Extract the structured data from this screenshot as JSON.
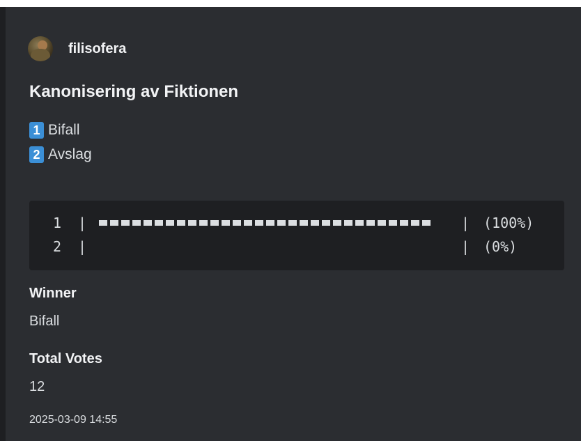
{
  "author": {
    "name": "filisofera",
    "avatar_icon": "avatar-photo"
  },
  "poll": {
    "title": "Kanonisering av Fiktionen",
    "options": [
      {
        "number": "1",
        "label": "Bifall"
      },
      {
        "number": "2",
        "label": "Avslag"
      }
    ]
  },
  "results": {
    "rows": [
      {
        "number": "1",
        "fraction": 1.0,
        "percent_text": "(100%)"
      },
      {
        "number": "2",
        "fraction": 0.0,
        "percent_text": "(0%)"
      }
    ],
    "separator": "|"
  },
  "fields": {
    "winner_label": "Winner",
    "winner_value": "Bifall",
    "total_label": "Total Votes",
    "total_value": "12"
  },
  "timestamp": "2025-03-09 14:55",
  "colors": {
    "background": "#2b2d31",
    "code_background": "#1e1f22",
    "badge": "#3b8fd6",
    "text": "#dbdee1"
  }
}
